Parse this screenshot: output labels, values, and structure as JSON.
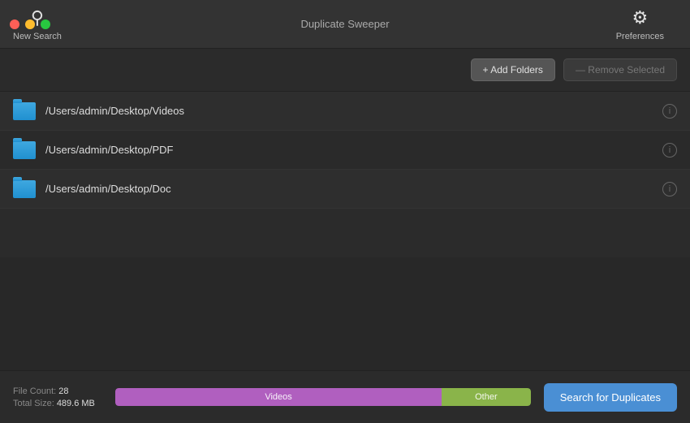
{
  "window": {
    "title": "Duplicate Sweeper"
  },
  "toolbar": {
    "new_search_label": "New Search",
    "preferences_label": "Preferences"
  },
  "action_bar": {
    "add_folders_label": "+ Add Folders",
    "remove_selected_label": "— Remove Selected"
  },
  "folders": [
    {
      "path": "/Users/admin/Desktop/Videos"
    },
    {
      "path": "/Users/admin/Desktop/PDF"
    },
    {
      "path": "/Users/admin/Desktop/Doc"
    }
  ],
  "stats": {
    "file_count_label": "File Count:",
    "file_count_value": "28",
    "total_size_label": "Total Size:",
    "total_size_value": "489.6 MB"
  },
  "storage_bar": {
    "videos_label": "Videos",
    "other_label": "Other"
  },
  "search_button": {
    "label": "Search for Duplicates"
  },
  "icons": {
    "search": "⌕",
    "gear": "⚙",
    "info": "i"
  }
}
